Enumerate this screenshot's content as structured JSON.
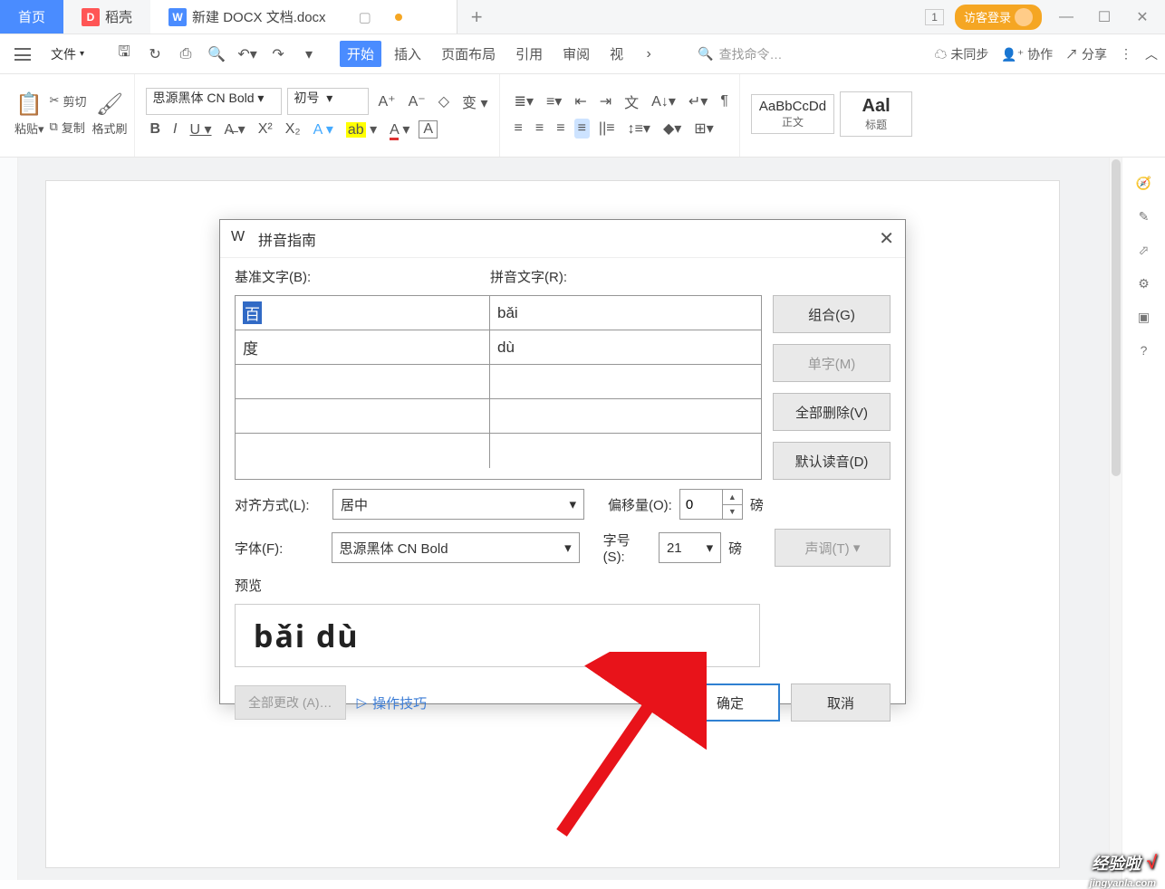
{
  "tabs": {
    "home": "首页",
    "daoke": "稻壳",
    "doc": "新建 DOCX 文档.docx",
    "badge": "1",
    "login": "访客登录"
  },
  "menu": {
    "file": "文件",
    "items": [
      "开始",
      "插入",
      "页面布局",
      "引用",
      "审阅",
      "视"
    ],
    "search_placeholder": "查找命令…",
    "unsync": "未同步",
    "collab": "协作",
    "share": "分享"
  },
  "ribbon": {
    "paste": "粘贴",
    "cut": "剪切",
    "copy": "复制",
    "format_painter": "格式刷",
    "font_name": "思源黑体 CN Bold",
    "font_size": "初号",
    "style_normal_sample": "AaBbCcDd",
    "style_normal": "正文",
    "style_heading_sample": "Aal",
    "style_heading": "标题"
  },
  "dialog": {
    "title": "拼音指南",
    "base_label": "基准文字(B):",
    "pinyin_label": "拼音文字(R):",
    "rows": [
      {
        "base": "百",
        "pinyin": "bǎi",
        "selected": true
      },
      {
        "base": "度",
        "pinyin": "dù",
        "selected": false
      },
      {
        "base": "",
        "pinyin": ""
      },
      {
        "base": "",
        "pinyin": ""
      },
      {
        "base": "",
        "pinyin": ""
      }
    ],
    "btn_combine": "组合(G)",
    "btn_single": "单字(M)",
    "btn_delete_all": "全部删除(V)",
    "btn_default": "默认读音(D)",
    "align_label": "对齐方式(L):",
    "align_value": "居中",
    "offset_label": "偏移量(O):",
    "offset_value": "0",
    "unit": "磅",
    "font_label": "字体(F):",
    "font_value": "思源黑体 CN Bold",
    "size_label": "字号(S):",
    "size_value": "21",
    "tone_label": "声调(T)",
    "preview_label": "预览",
    "preview_text": "bǎi  dù",
    "change_all": "全部更改 (A)…",
    "tips": "操作技巧",
    "ok": "确定",
    "cancel": "取消"
  },
  "watermark": {
    "main": "经验啦",
    "sub": "jingyanla.com"
  }
}
